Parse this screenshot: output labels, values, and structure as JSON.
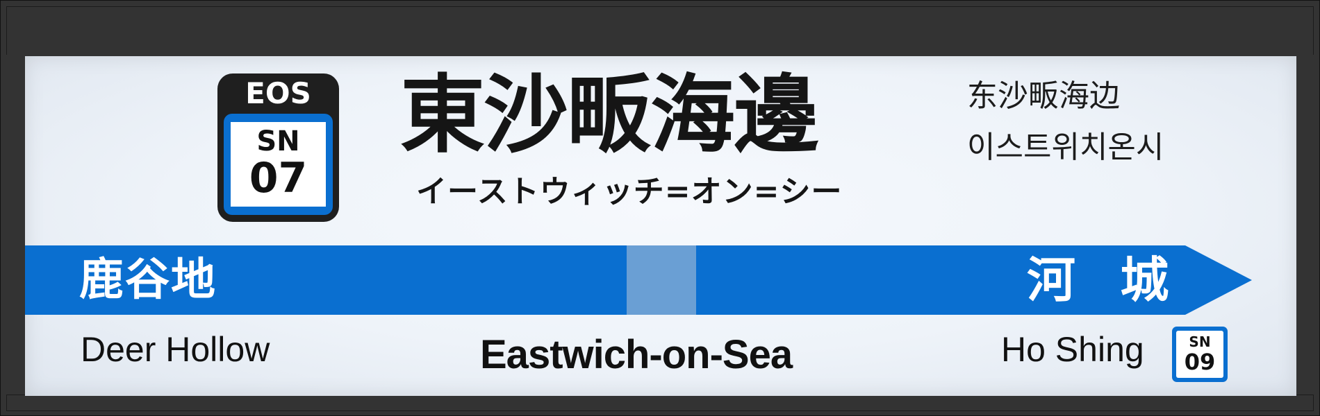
{
  "colors": {
    "line_blue": "#0a6fd0",
    "current_segment": "#6a9fd4",
    "frame": "#333333",
    "badge_dark": "#1f1f1f"
  },
  "badge": {
    "line_code": "EOS",
    "station_code": "SN",
    "station_number": "07"
  },
  "station": {
    "name_ja": "東沙畈海邊",
    "name_kana": "イーストウィッチ=オン=シー",
    "name_zh": "东沙畈海边",
    "name_ko": "이스트위치온시",
    "name_en": "Eastwich-on-Sea"
  },
  "previous_station": {
    "name_ja": "鹿谷地",
    "name_en": "Deer Hollow"
  },
  "next_station": {
    "name_ja": "河 城",
    "name_en": "Ho Shing",
    "code": "SN",
    "number": "09"
  },
  "icons": {
    "direction": "arrow-right-icon"
  }
}
